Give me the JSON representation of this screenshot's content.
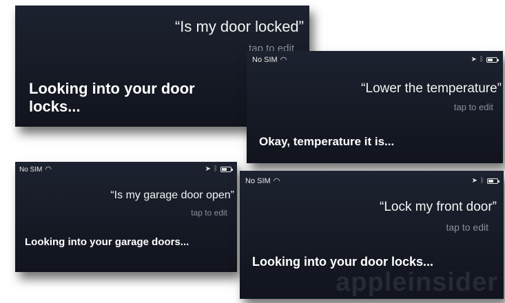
{
  "panels": [
    {
      "quote": "“Is my door locked”",
      "tap": "tap to edit",
      "response": "Looking into your door locks..."
    },
    {
      "status": {
        "carrier": "No SIM"
      },
      "quote": "“Lower the temperature”",
      "tap": "tap to edit",
      "response": "Okay, temperature it is..."
    },
    {
      "status": {
        "carrier": "No SIM"
      },
      "quote": "“Is my garage door open”",
      "tap": "tap to edit",
      "response": "Looking into your garage doors..."
    },
    {
      "status": {
        "carrier": "No SIM"
      },
      "quote": "“Lock my front door”",
      "tap": "tap to edit",
      "response": "Looking into your door locks..."
    }
  ],
  "icons": {
    "wifi": "wifi-icon",
    "location": "location-arrow-icon",
    "bluetooth": "bluetooth-icon",
    "battery": "battery-icon"
  },
  "watermark": "appleinsider",
  "colors": {
    "panel_bg": "#161a25",
    "tap_text": "#8a8f9a"
  }
}
